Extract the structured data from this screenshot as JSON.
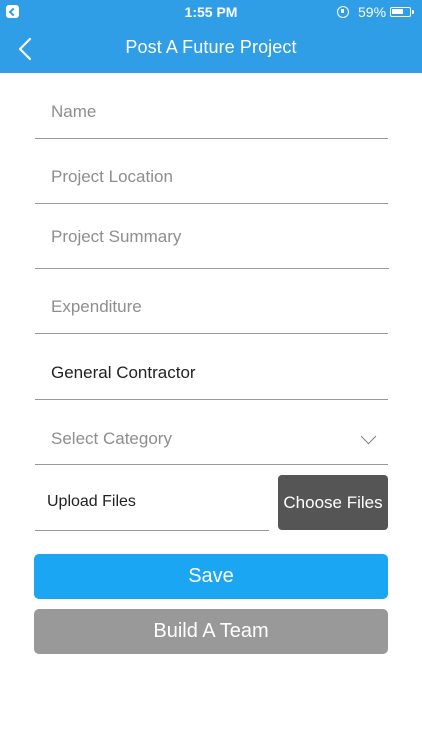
{
  "status_bar": {
    "time": "1:55 PM",
    "battery_percent": "59%",
    "battery_level": 0.59
  },
  "header": {
    "title": "Post A Future Project"
  },
  "form": {
    "name_placeholder": "Name",
    "location_placeholder": "Project Location",
    "summary_placeholder": "Project Summary",
    "expenditure_placeholder": "Expenditure",
    "role_value": "General Contractor",
    "category_placeholder": "Select Category",
    "upload_label": "Upload Files",
    "choose_files_label": "Choose Files"
  },
  "actions": {
    "save_label": "Save",
    "build_team_label": "Build A Team"
  },
  "colors": {
    "header_bg": "#2f9ee6",
    "save_bg": "#1ba6f3",
    "build_team_bg": "#999999",
    "choose_files_bg": "#555555"
  }
}
